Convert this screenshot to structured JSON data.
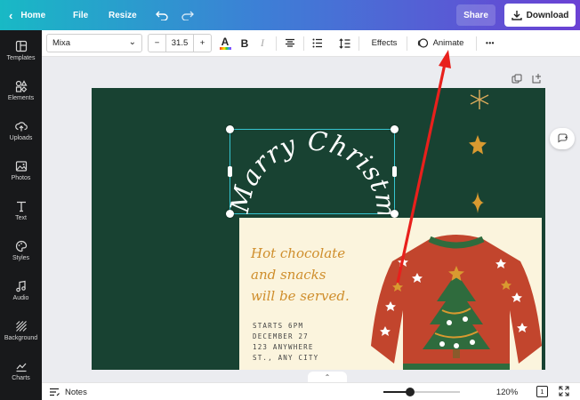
{
  "topbar": {
    "home_label": "Home",
    "file_label": "File",
    "resize_label": "Resize",
    "share_label": "Share",
    "download_label": "Download"
  },
  "sidebar": {
    "items": [
      {
        "label": "Templates",
        "icon": "templates-icon"
      },
      {
        "label": "Elements",
        "icon": "elements-icon"
      },
      {
        "label": "Uploads",
        "icon": "upload-icon"
      },
      {
        "label": "Photos",
        "icon": "photo-icon"
      },
      {
        "label": "Text",
        "icon": "text-icon"
      },
      {
        "label": "Styles",
        "icon": "palette-icon"
      },
      {
        "label": "Audio",
        "icon": "music-icon"
      },
      {
        "label": "Background",
        "icon": "background-icon"
      },
      {
        "label": "Charts",
        "icon": "chart-icon"
      }
    ]
  },
  "toolbar": {
    "font": "Mixa",
    "font_size": "31.5",
    "minus": "−",
    "plus": "+",
    "bold": "B",
    "italic": "I",
    "effects_label": "Effects",
    "animate_label": "Animate",
    "more": "•••",
    "text_color": "#1a1a1a"
  },
  "design": {
    "headline": "Marry Christmas",
    "card_lines": [
      "Hot chocolate",
      "and snacks",
      "will be served."
    ],
    "info_lines": [
      "STARTS 6PM",
      "DECEMBER 27",
      "123 ANYWHERE",
      "ST., ANY CITY"
    ],
    "background_color": "#184232",
    "card_color": "#fbf4dd",
    "accent_color": "#cf8e2c",
    "sweater_color": "#c2452d",
    "tree_color": "#2f6b3d"
  },
  "bottombar": {
    "notes_label": "Notes",
    "zoom": "120%",
    "page_count": "1",
    "zoom_slider_fraction": 0.35
  },
  "annotation": {
    "arrow_color": "#e8201c"
  }
}
